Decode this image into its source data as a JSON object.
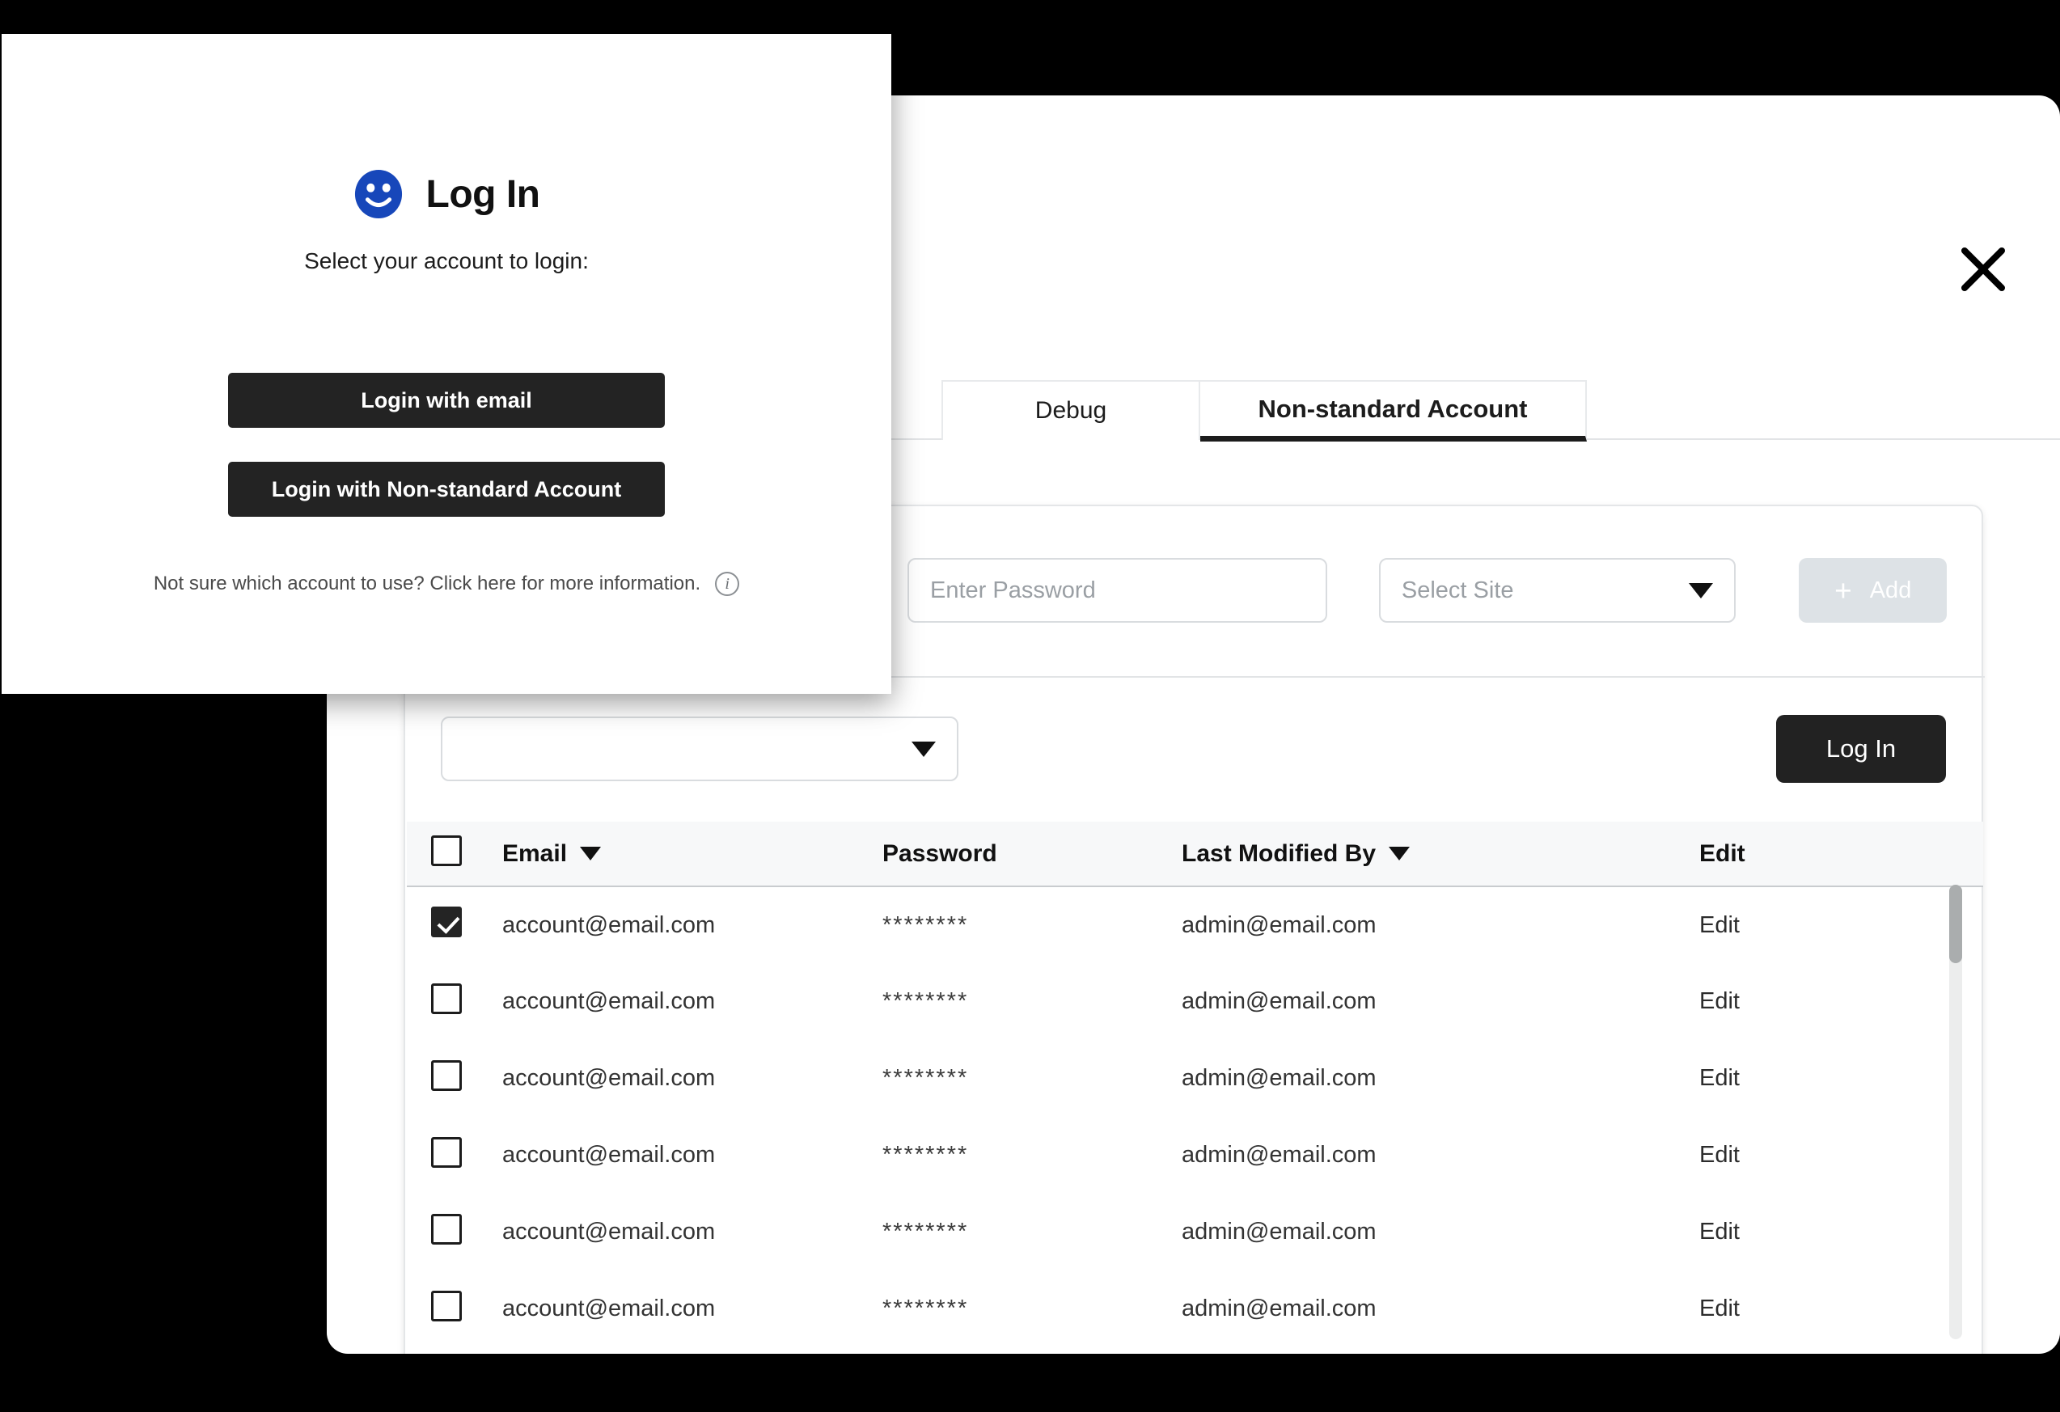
{
  "window": {
    "close_icon": "close-icon"
  },
  "tabs": [
    {
      "label": "Debug",
      "active": false
    },
    {
      "label": "Non-standard Account",
      "active": true
    }
  ],
  "form": {
    "password_placeholder": "Enter Password",
    "site_placeholder": "Select Site",
    "add_label": "Add",
    "add_plus": "+",
    "login_label": "Log In"
  },
  "table": {
    "columns": [
      {
        "label": "",
        "sortable": false
      },
      {
        "label": "Email",
        "sortable": true
      },
      {
        "label": "Password",
        "sortable": false
      },
      {
        "label": "Last Modified By",
        "sortable": true
      },
      {
        "label": "Edit",
        "sortable": false
      }
    ],
    "edit_label": "Edit",
    "rows": [
      {
        "checked": true,
        "email": "account@email.com",
        "password": "********",
        "modified_by": "admin@email.com",
        "edit": "Edit"
      },
      {
        "checked": false,
        "email": "account@email.com",
        "password": "********",
        "modified_by": "admin@email.com",
        "edit": "Edit"
      },
      {
        "checked": false,
        "email": "account@email.com",
        "password": "********",
        "modified_by": "admin@email.com",
        "edit": "Edit"
      },
      {
        "checked": false,
        "email": "account@email.com",
        "password": "********",
        "modified_by": "admin@email.com",
        "edit": "Edit"
      },
      {
        "checked": false,
        "email": "account@email.com",
        "password": "********",
        "modified_by": "admin@email.com",
        "edit": "Edit"
      },
      {
        "checked": false,
        "email": "account@email.com",
        "password": "********",
        "modified_by": "admin@email.com",
        "edit": "Edit"
      }
    ]
  },
  "modal": {
    "icon": "smiley-face-icon",
    "icon_color": "#1747ba",
    "title": "Log In",
    "subtitle": "Select your account to login:",
    "buttons": [
      {
        "label": "Login with email"
      },
      {
        "label": "Login with Non-standard Account"
      }
    ],
    "help_text": "Not sure which account to use? Click here for more information.",
    "help_icon": "info-icon"
  },
  "colors": {
    "accent_blue": "#1747ba",
    "dark": "#232323",
    "disabled": "#dde2e6",
    "page_background": "#000000"
  }
}
